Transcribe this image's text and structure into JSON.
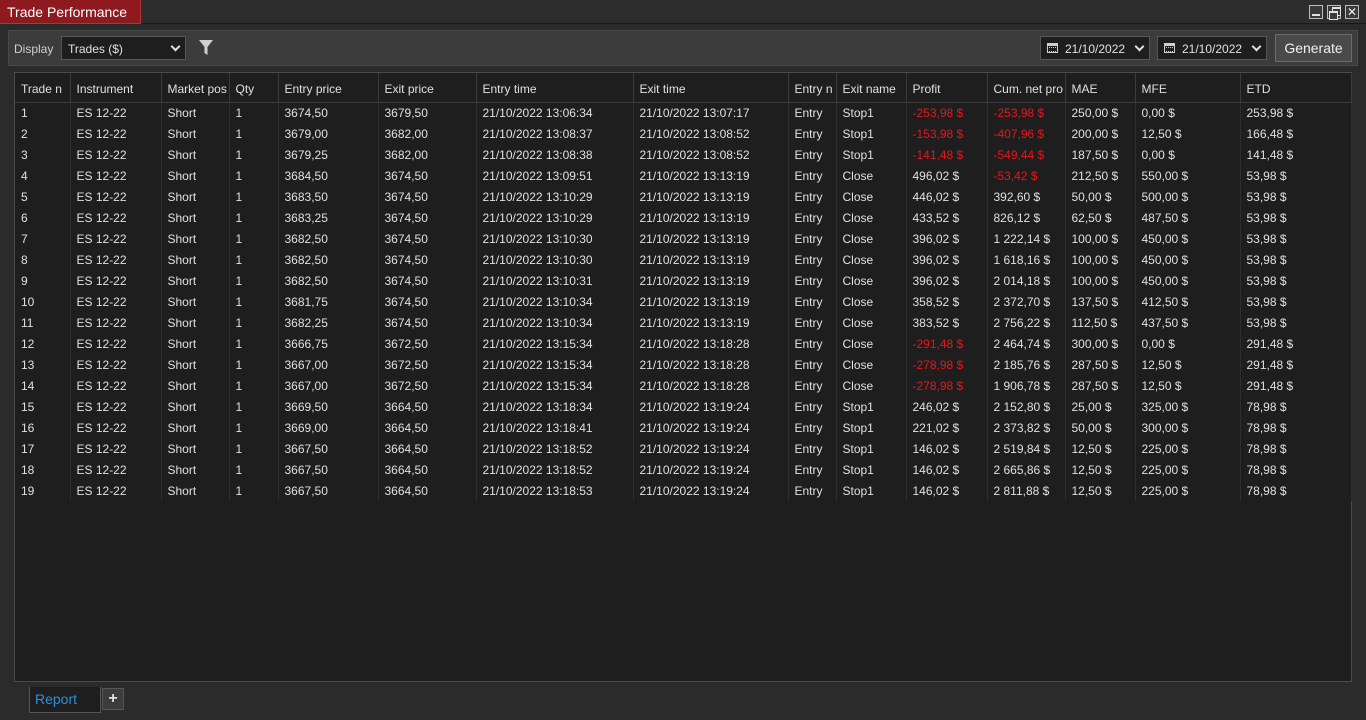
{
  "window": {
    "title": "Trade Performance",
    "close_glyph": "✕"
  },
  "toolbar": {
    "display_label": "Display",
    "display_value": "Trades ($)",
    "date_from": "21/10/2022",
    "date_to": "21/10/2022",
    "generate_label": "Generate"
  },
  "grid": {
    "columns": [
      "Trade n",
      "Instrument",
      "Market pos",
      "Qty",
      "Entry price",
      "Exit price",
      "Entry time",
      "Exit time",
      "Entry n",
      "Exit name",
      "Profit",
      "Cum. net pro",
      "MAE",
      "MFE",
      "ETD"
    ],
    "rows": [
      [
        "1",
        "ES 12-22",
        "Short",
        "1",
        "3674,50",
        "3679,50",
        "21/10/2022 13:06:34",
        "21/10/2022 13:07:17",
        "Entry",
        "Stop1",
        "-253,98 $",
        "-253,98 $",
        "250,00 $",
        "0,00 $",
        "253,98 $"
      ],
      [
        "2",
        "ES 12-22",
        "Short",
        "1",
        "3679,00",
        "3682,00",
        "21/10/2022 13:08:37",
        "21/10/2022 13:08:52",
        "Entry",
        "Stop1",
        "-153,98 $",
        "-407,96 $",
        "200,00 $",
        "12,50 $",
        "166,48 $"
      ],
      [
        "3",
        "ES 12-22",
        "Short",
        "1",
        "3679,25",
        "3682,00",
        "21/10/2022 13:08:38",
        "21/10/2022 13:08:52",
        "Entry",
        "Stop1",
        "-141,48 $",
        "-549,44 $",
        "187,50 $",
        "0,00 $",
        "141,48 $"
      ],
      [
        "4",
        "ES 12-22",
        "Short",
        "1",
        "3684,50",
        "3674,50",
        "21/10/2022 13:09:51",
        "21/10/2022 13:13:19",
        "Entry",
        "Close",
        "496,02 $",
        "-53,42 $",
        "212,50 $",
        "550,00 $",
        "53,98 $"
      ],
      [
        "5",
        "ES 12-22",
        "Short",
        "1",
        "3683,50",
        "3674,50",
        "21/10/2022 13:10:29",
        "21/10/2022 13:13:19",
        "Entry",
        "Close",
        "446,02 $",
        "392,60 $",
        "50,00 $",
        "500,00 $",
        "53,98 $"
      ],
      [
        "6",
        "ES 12-22",
        "Short",
        "1",
        "3683,25",
        "3674,50",
        "21/10/2022 13:10:29",
        "21/10/2022 13:13:19",
        "Entry",
        "Close",
        "433,52 $",
        "826,12 $",
        "62,50 $",
        "487,50 $",
        "53,98 $"
      ],
      [
        "7",
        "ES 12-22",
        "Short",
        "1",
        "3682,50",
        "3674,50",
        "21/10/2022 13:10:30",
        "21/10/2022 13:13:19",
        "Entry",
        "Close",
        "396,02 $",
        "1 222,14 $",
        "100,00 $",
        "450,00 $",
        "53,98 $"
      ],
      [
        "8",
        "ES 12-22",
        "Short",
        "1",
        "3682,50",
        "3674,50",
        "21/10/2022 13:10:30",
        "21/10/2022 13:13:19",
        "Entry",
        "Close",
        "396,02 $",
        "1 618,16 $",
        "100,00 $",
        "450,00 $",
        "53,98 $"
      ],
      [
        "9",
        "ES 12-22",
        "Short",
        "1",
        "3682,50",
        "3674,50",
        "21/10/2022 13:10:31",
        "21/10/2022 13:13:19",
        "Entry",
        "Close",
        "396,02 $",
        "2 014,18 $",
        "100,00 $",
        "450,00 $",
        "53,98 $"
      ],
      [
        "10",
        "ES 12-22",
        "Short",
        "1",
        "3681,75",
        "3674,50",
        "21/10/2022 13:10:34",
        "21/10/2022 13:13:19",
        "Entry",
        "Close",
        "358,52 $",
        "2 372,70 $",
        "137,50 $",
        "412,50 $",
        "53,98 $"
      ],
      [
        "11",
        "ES 12-22",
        "Short",
        "1",
        "3682,25",
        "3674,50",
        "21/10/2022 13:10:34",
        "21/10/2022 13:13:19",
        "Entry",
        "Close",
        "383,52 $",
        "2 756,22 $",
        "112,50 $",
        "437,50 $",
        "53,98 $"
      ],
      [
        "12",
        "ES 12-22",
        "Short",
        "1",
        "3666,75",
        "3672,50",
        "21/10/2022 13:15:34",
        "21/10/2022 13:18:28",
        "Entry",
        "Close",
        "-291,48 $",
        "2 464,74 $",
        "300,00 $",
        "0,00 $",
        "291,48 $"
      ],
      [
        "13",
        "ES 12-22",
        "Short",
        "1",
        "3667,00",
        "3672,50",
        "21/10/2022 13:15:34",
        "21/10/2022 13:18:28",
        "Entry",
        "Close",
        "-278,98 $",
        "2 185,76 $",
        "287,50 $",
        "12,50 $",
        "291,48 $"
      ],
      [
        "14",
        "ES 12-22",
        "Short",
        "1",
        "3667,00",
        "3672,50",
        "21/10/2022 13:15:34",
        "21/10/2022 13:18:28",
        "Entry",
        "Close",
        "-278,98 $",
        "1 906,78 $",
        "287,50 $",
        "12,50 $",
        "291,48 $"
      ],
      [
        "15",
        "ES 12-22",
        "Short",
        "1",
        "3669,50",
        "3664,50",
        "21/10/2022 13:18:34",
        "21/10/2022 13:19:24",
        "Entry",
        "Stop1",
        "246,02 $",
        "2 152,80 $",
        "25,00 $",
        "325,00 $",
        "78,98 $"
      ],
      [
        "16",
        "ES 12-22",
        "Short",
        "1",
        "3669,00",
        "3664,50",
        "21/10/2022 13:18:41",
        "21/10/2022 13:19:24",
        "Entry",
        "Stop1",
        "221,02 $",
        "2 373,82 $",
        "50,00 $",
        "300,00 $",
        "78,98 $"
      ],
      [
        "17",
        "ES 12-22",
        "Short",
        "1",
        "3667,50",
        "3664,50",
        "21/10/2022 13:18:52",
        "21/10/2022 13:19:24",
        "Entry",
        "Stop1",
        "146,02 $",
        "2 519,84 $",
        "12,50 $",
        "225,00 $",
        "78,98 $"
      ],
      [
        "18",
        "ES 12-22",
        "Short",
        "1",
        "3667,50",
        "3664,50",
        "21/10/2022 13:18:52",
        "21/10/2022 13:19:24",
        "Entry",
        "Stop1",
        "146,02 $",
        "2 665,86 $",
        "12,50 $",
        "225,00 $",
        "78,98 $"
      ],
      [
        "19",
        "ES 12-22",
        "Short",
        "1",
        "3667,50",
        "3664,50",
        "21/10/2022 13:18:53",
        "21/10/2022 13:19:24",
        "Entry",
        "Stop1",
        "146,02 $",
        "2 811,88 $",
        "12,50 $",
        "225,00 $",
        "78,98 $"
      ]
    ]
  },
  "tabs": {
    "report_label": "Report",
    "add_label": "+"
  },
  "colors": {
    "title_accent": "#8e1a1f",
    "negative": "#e8161b",
    "active_tab_text": "#2f8fde"
  },
  "icons": {
    "filter": "filter-icon",
    "calendar": "calendar-icon",
    "dropdown": "chevron-down-icon"
  }
}
